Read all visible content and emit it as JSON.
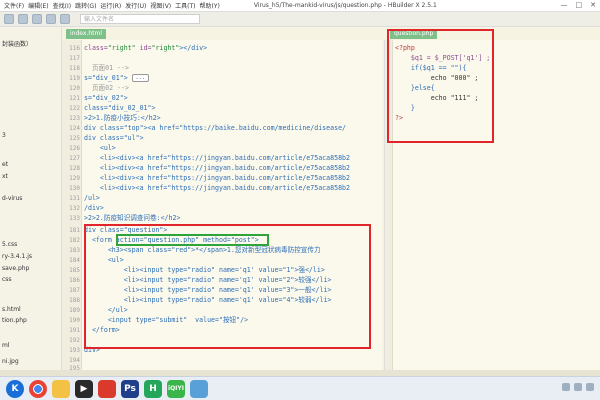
{
  "menubar": {
    "items": [
      "文件(F)",
      "编辑(E)",
      "查找(I)",
      "跳转(G)",
      "运行(R)",
      "发行(U)",
      "视图(V)",
      "工具(T)",
      "帮助(Y)"
    ],
    "title": "Virus_h5/The-mankid-virus/js/question.php - HBuilder X 2.5.1",
    "controls": [
      "—",
      "□",
      "✕"
    ]
  },
  "toolbar": {
    "input_placeholder": "输入文件名"
  },
  "sidebar": {
    "items": [
      "封装函数）",
      "3",
      "et",
      "xt",
      "d-virus",
      "5.css",
      "ry-3.4.1.js",
      "save.php",
      "css",
      "s.html",
      "tion.php",
      "ml",
      "ni.jpg"
    ]
  },
  "tabs": {
    "left": "index.html",
    "right": "question.php"
  },
  "left_editor": {
    "lines": [
      {
        "n": "116",
        "code": "class=\"right\" id=\"right\"></div>"
      },
      {
        "n": "117",
        "code": ""
      },
      {
        "n": "118",
        "code": "  页面01 -->"
      },
      {
        "n": "119",
        "code": "s=\"div_01\">"
      },
      {
        "n": "120",
        "code": "  页面02 -->"
      },
      {
        "n": "121",
        "code": "s=\"div_02\">"
      },
      {
        "n": "122",
        "code": "class=\"div_02_01\">"
      },
      {
        "n": "123",
        "code": ">2>1.防疫小技巧:</h2>"
      },
      {
        "n": "124",
        "code": "div class=\"top\"><a href=\"https://baike.baidu.com/medicine/disease/"
      },
      {
        "n": "125",
        "code": "div class=\"ul\">"
      },
      {
        "n": "126",
        "code": "    <ul>"
      },
      {
        "n": "127",
        "code": "    <li><div><a href=\"https://jingyan.baidu.com/article/e75aca858b2"
      },
      {
        "n": "128",
        "code": "    <li><div><a href=\"https://jingyan.baidu.com/article/e75aca858b2"
      },
      {
        "n": "129",
        "code": "    <li><div><a href=\"https://jingyan.baidu.com/article/e75aca858b2"
      },
      {
        "n": "130",
        "code": "    <li><div><a href=\"https://jingyan.baidu.com/article/e75aca858b2"
      },
      {
        "n": "131",
        "code": "/ul>"
      },
      {
        "n": "132",
        "code": "/div>"
      },
      {
        "n": "133",
        "code": ">2>2.防疫知识调查问卷:</h2>"
      },
      {
        "n": "181",
        "code": "div class=\"question\">"
      },
      {
        "n": "182",
        "code": "  <form action=\"question.php\" method=\"post\">"
      },
      {
        "n": "183",
        "code": "      <h3><span class=\"red\">*</span>1.您对新型冠状病毒防控宣传力"
      },
      {
        "n": "184",
        "code": "      <ul>"
      },
      {
        "n": "185",
        "code": "          <li><input type=\"radio\" name='q1' value=\"1\">强</li>"
      },
      {
        "n": "186",
        "code": "          <li><input type=\"radio\" name='q1' value=\"2\">较强</li>"
      },
      {
        "n": "187",
        "code": "          <li><input type=\"radio\" name='q1' value=\"3\">一般</li>"
      },
      {
        "n": "188",
        "code": "          <li><input type=\"radio\" name='q1' value=\"4\">较弱</li>"
      },
      {
        "n": "189",
        "code": "      </ul>"
      },
      {
        "n": "190",
        "code": "      <input type=\"submit\"  value=\"按钮\"/>"
      },
      {
        "n": "191",
        "code": "  </form>"
      },
      {
        "n": "192",
        "code": ""
      },
      {
        "n": "193",
        "code": "div>"
      },
      {
        "n": "194",
        "code": ""
      },
      {
        "n": "195",
        "code": ""
      }
    ],
    "fold_label": "..."
  },
  "right_editor": {
    "lines": [
      {
        "n": "",
        "code": "<?php"
      },
      {
        "n": "",
        "code": "    $q1 = $_POST['q1'] ;"
      },
      {
        "n": "",
        "code": "    if($q1 == \"\"){"
      },
      {
        "n": "",
        "code": "         echo \"000\" ;"
      },
      {
        "n": "",
        "code": "    }else{"
      },
      {
        "n": "",
        "code": "         echo \"111\" ;"
      },
      {
        "n": "",
        "code": "    }"
      },
      {
        "n": "",
        "code": "?>"
      }
    ]
  },
  "colors": {
    "highlight_red": "#e0262b",
    "highlight_green": "#2ea43a",
    "tab_green": "#7fbf8a"
  },
  "taskbar": {
    "apps": [
      {
        "name": "k-browser",
        "label": "K"
      },
      {
        "name": "chrome",
        "label": ""
      },
      {
        "name": "folder",
        "label": ""
      },
      {
        "name": "media-player",
        "label": "▶"
      },
      {
        "name": "red-app",
        "label": ""
      },
      {
        "name": "photoshop",
        "label": "Ps"
      },
      {
        "name": "hbuilder",
        "label": "H"
      },
      {
        "name": "iqiyi",
        "label": "iQIYI"
      },
      {
        "name": "photos",
        "label": ""
      }
    ]
  }
}
